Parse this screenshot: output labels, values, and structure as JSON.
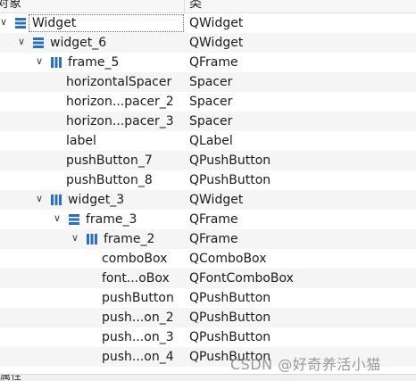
{
  "header": {
    "col_object": "对象",
    "col_class": "类"
  },
  "rows": [
    {
      "name": "Widget",
      "cls": "QWidget",
      "depth": 0,
      "arrow": "down",
      "icon": "layout-vertical-icon",
      "selected": true
    },
    {
      "name": "widget_6",
      "cls": "QWidget",
      "depth": 1,
      "arrow": "down",
      "icon": "layout-vertical-icon"
    },
    {
      "name": "frame_5",
      "cls": "QFrame",
      "depth": 2,
      "arrow": "down",
      "icon": "layout-horizontal-icon"
    },
    {
      "name": "horizontalSpacer",
      "cls": "Spacer",
      "depth": 3
    },
    {
      "name": "horizon...pacer_2",
      "cls": "Spacer",
      "depth": 3
    },
    {
      "name": "horizon...pacer_3",
      "cls": "Spacer",
      "depth": 3
    },
    {
      "name": "label",
      "cls": "QLabel",
      "depth": 3
    },
    {
      "name": "pushButton_7",
      "cls": "QPushButton",
      "depth": 3
    },
    {
      "name": "pushButton_8",
      "cls": "QPushButton",
      "depth": 3
    },
    {
      "name": "widget_3",
      "cls": "QWidget",
      "depth": 2,
      "arrow": "down",
      "icon": "layout-horizontal-icon"
    },
    {
      "name": "frame_3",
      "cls": "QFrame",
      "depth": 3,
      "arrow": "down",
      "icon": "layout-vertical-icon"
    },
    {
      "name": "frame_2",
      "cls": "QFrame",
      "depth": 4,
      "arrow": "down",
      "icon": "layout-horizontal-icon"
    },
    {
      "name": "comboBox",
      "cls": "QComboBox",
      "depth": 5
    },
    {
      "name": "font...oBox",
      "cls": "QFontComboBox",
      "depth": 5
    },
    {
      "name": "pushButton",
      "cls": "QPushButton",
      "depth": 5
    },
    {
      "name": "push...on_2",
      "cls": "QPushButton",
      "depth": 5
    },
    {
      "name": "push...on_3",
      "cls": "QPushButton",
      "depth": 5
    },
    {
      "name": "push...on_4",
      "cls": "QPushButton",
      "depth": 5
    }
  ],
  "footer": {
    "text": "属性"
  },
  "watermark": "CSDN @好奇养活小猫",
  "colors": {
    "icon_blue": "#2b6fc2",
    "alt_row": "#f5f5f5"
  }
}
